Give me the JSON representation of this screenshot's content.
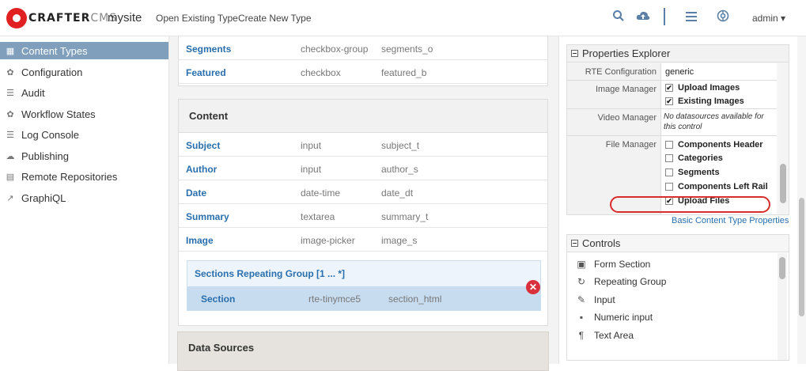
{
  "header": {
    "logo_text": "CRAFTER",
    "logo_text2": "CMS",
    "site": "mysite",
    "nav": [
      "Open Existing Type",
      "Create New Type"
    ],
    "icons": [
      "search-icon",
      "cloud-upload-icon",
      "menu-icon",
      "globe-icon"
    ],
    "user": "admin"
  },
  "sidebar": {
    "items": [
      {
        "label": "Content Types",
        "icon": "grid-icon",
        "active": true
      },
      {
        "label": "Configuration",
        "icon": "gear-icon"
      },
      {
        "label": "Audit",
        "icon": "list-icon"
      },
      {
        "label": "Workflow States",
        "icon": "gear-icon"
      },
      {
        "label": "Log Console",
        "icon": "list-icon"
      },
      {
        "label": "Publishing",
        "icon": "cloud-icon"
      },
      {
        "label": "Remote Repositories",
        "icon": "database-icon"
      },
      {
        "label": "GraphiQL",
        "icon": "chart-icon"
      }
    ]
  },
  "main": {
    "top_fields": [
      {
        "name": "Segments",
        "type": "checkbox-group",
        "id": "segments_o"
      },
      {
        "name": "Featured",
        "type": "checkbox",
        "id": "featured_b"
      }
    ],
    "content_panel": {
      "title": "Content",
      "fields": [
        {
          "name": "Subject",
          "type": "input",
          "id": "subject_t"
        },
        {
          "name": "Author",
          "type": "input",
          "id": "author_s"
        },
        {
          "name": "Date",
          "type": "date-time",
          "id": "date_dt"
        },
        {
          "name": "Summary",
          "type": "textarea",
          "id": "summary_t"
        },
        {
          "name": "Image",
          "type": "image-picker",
          "id": "image_s"
        }
      ],
      "repeating_group": {
        "title": "Sections Repeating Group [1 ... *]",
        "field": {
          "name": "Section",
          "type": "rte-tinymce5",
          "id": "section_html"
        }
      }
    },
    "data_sources_title": "Data Sources"
  },
  "properties": {
    "title": "Properties Explorer",
    "rte_label": "RTE Configuration",
    "rte_value": "generic",
    "image_label": "Image Manager",
    "image_opts": [
      {
        "label": "Upload Images",
        "checked": true
      },
      {
        "label": "Existing Images",
        "checked": true
      }
    ],
    "video_label": "Video Manager",
    "video_value": "No datasources available for this control",
    "file_label": "File Manager",
    "file_opts": [
      {
        "label": "Components Header",
        "checked": false
      },
      {
        "label": "Categories",
        "checked": false
      },
      {
        "label": "Segments",
        "checked": false
      },
      {
        "label": "Components Left Rail",
        "checked": false
      },
      {
        "label": "Upload Files",
        "checked": true
      }
    ],
    "link": "Basic Content Type Properties"
  },
  "controls": {
    "title": "Controls",
    "items": [
      {
        "label": "Form Section",
        "icon": "form-section-icon"
      },
      {
        "label": "Repeating Group",
        "icon": "repeat-icon"
      },
      {
        "label": "Input",
        "icon": "edit-icon"
      },
      {
        "label": "Numeric input",
        "icon": "numeric-icon"
      },
      {
        "label": "Text Area",
        "icon": "paragraph-icon"
      }
    ]
  }
}
